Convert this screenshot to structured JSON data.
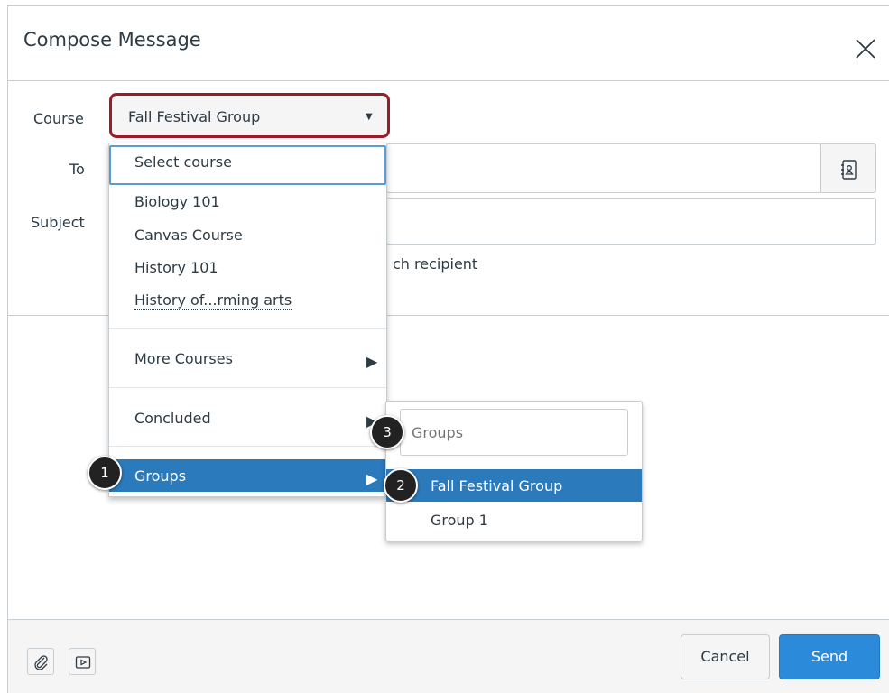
{
  "dialog": {
    "title": "Compose Message",
    "close_icon": "close-icon"
  },
  "form": {
    "course_label": "Course",
    "course_value": "Fall Festival Group",
    "to_label": "To",
    "subject_label": "Subject",
    "address_book_icon": "address-book-icon",
    "behind_text": "ch recipient"
  },
  "course_menu": {
    "items": [
      {
        "label": "Select course"
      },
      {
        "label": "Biology 101"
      },
      {
        "label": "Canvas Course"
      },
      {
        "label": "History 101"
      },
      {
        "label": "History of...rming arts"
      },
      {
        "label": "More Courses"
      },
      {
        "label": "Concluded"
      },
      {
        "label": "Groups"
      }
    ]
  },
  "groups_submenu": {
    "search_placeholder": "Groups",
    "items": [
      {
        "label": "Fall Festival Group"
      },
      {
        "label": "Group 1"
      }
    ]
  },
  "badges": [
    "1",
    "2",
    "3"
  ],
  "footer": {
    "attach_icon": "paperclip-icon",
    "media_icon": "media-icon",
    "cancel_label": "Cancel",
    "send_label": "Send"
  },
  "colors": {
    "highlight_border": "#9b1c25",
    "active_item": "#2b7abc",
    "send_button": "#2b8ad9"
  }
}
